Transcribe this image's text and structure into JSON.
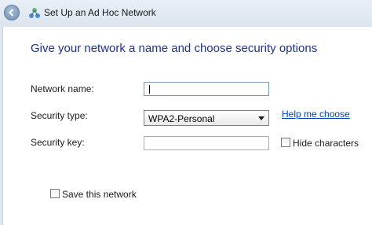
{
  "window": {
    "title": "Set Up an Ad Hoc Network",
    "back_icon": "back-arrow-icon",
    "app_icon": "network-icon"
  },
  "main": {
    "heading": "Give your network a name and choose security options",
    "network_name": {
      "label": "Network name:",
      "value": ""
    },
    "security_type": {
      "label": "Security type:",
      "selected": "WPA2-Personal",
      "help_link": "Help me choose"
    },
    "security_key": {
      "label": "Security key:",
      "value": ""
    },
    "hide_characters": {
      "label": "Hide characters",
      "checked": false
    },
    "save_network": {
      "label": "Save this network",
      "checked": false
    }
  },
  "colors": {
    "heading": "#1e3287",
    "link": "#0645ad",
    "frame": "#dfe6ee"
  }
}
